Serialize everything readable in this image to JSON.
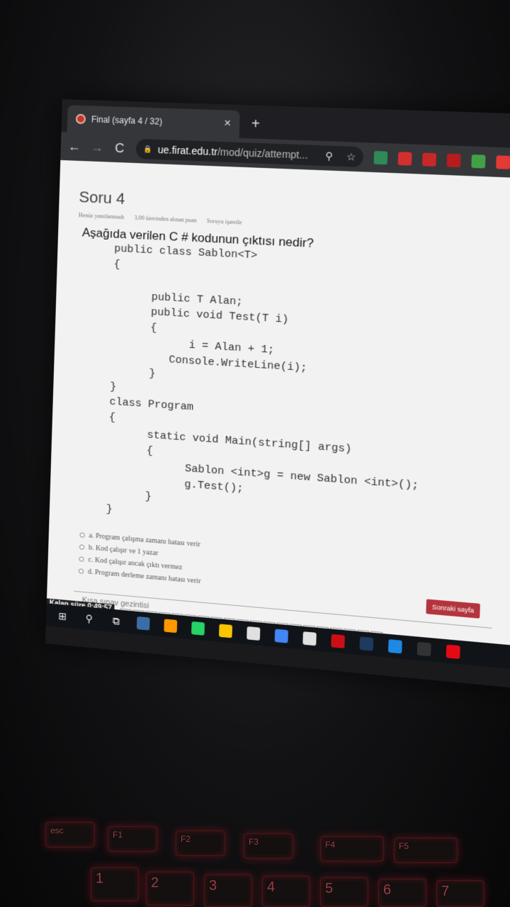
{
  "browser": {
    "tab_title": "Final (sayfa 4 / 32)",
    "tab_close": "×",
    "new_tab": "+",
    "url_host": "ue.firat.edu.tr",
    "url_path": "/mod/quiz/attempt...",
    "back": "←",
    "forward": "→",
    "reload": "C",
    "lock": "🔒",
    "zoom": "⚲",
    "star": "☆",
    "extensions": [
      "#2e8b57",
      "#d32f2f",
      "#c62828",
      "#b71c1c",
      "#43a047",
      "#e53935"
    ]
  },
  "quiz": {
    "heading": "Soru 4",
    "meta": [
      "Henüz yanıtlanmadı",
      "3,00 üzerinden alınan puan",
      "Soruyu işaretle"
    ],
    "question": "Aşağıda verilen C # kodunun çıktısı nedir?",
    "code": "public class Sablon<T>\n{\n\n      public T Alan;\n      public void Test(T i)\n      {\n            i = Alan + 1;\n         Console.WriteLine(i);\n      }\n}\nclass Program\n{\n      static void Main(string[] args)\n      {\n            Sablon <int>g = new Sablon <int>();\n            g.Test();\n      }\n}",
    "answers": [
      "a. Program çalışma zamanı hatası verir",
      "b. Kod çalışır ve 1 yazar",
      "c. Kod çalışır ancak çıktı vermez",
      "d. Program derleme zamanı hatası verir"
    ],
    "next_button": "Sonraki sayfa",
    "quiz_nav": "Kısa sınav gezintisi",
    "timer": "Kalan süre 0:49:57"
  },
  "taskbar": {
    "start": "⊞",
    "search": "⚲",
    "taskview": "⧉",
    "apps": [
      "#3a6ea5",
      "#ff9800",
      "#25d366",
      "#f9c400",
      "#e0e0e0",
      "#4285f4",
      "#e0e0e0",
      "#cc0f16",
      "#1e3a5f",
      "#1e88e5",
      "#333",
      "#e50914"
    ]
  },
  "keyboard": {
    "keys": [
      "esc",
      "F1",
      "F2",
      "F3",
      "F4",
      "F5",
      "1",
      "2",
      "3",
      "4",
      "5",
      "6",
      "7"
    ]
  }
}
